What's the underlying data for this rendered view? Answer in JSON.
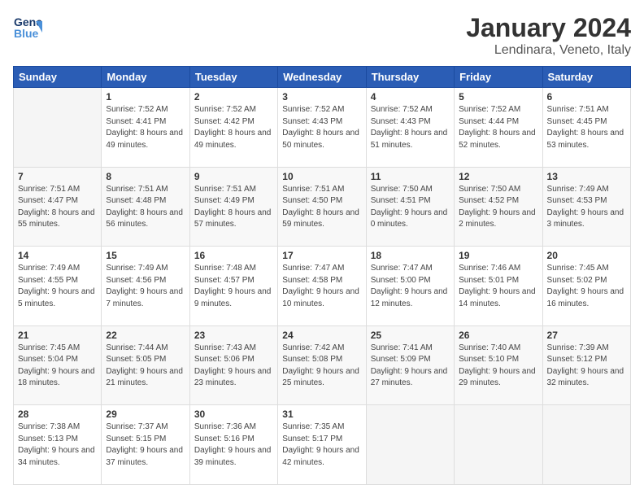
{
  "header": {
    "logo_line1": "General",
    "logo_line2": "Blue",
    "main_title": "January 2024",
    "subtitle": "Lendinara, Veneto, Italy"
  },
  "weekdays": [
    "Sunday",
    "Monday",
    "Tuesday",
    "Wednesday",
    "Thursday",
    "Friday",
    "Saturday"
  ],
  "weeks": [
    [
      {
        "day": "",
        "sunrise": "",
        "sunset": "",
        "daylight": ""
      },
      {
        "day": "1",
        "sunrise": "Sunrise: 7:52 AM",
        "sunset": "Sunset: 4:41 PM",
        "daylight": "Daylight: 8 hours and 49 minutes."
      },
      {
        "day": "2",
        "sunrise": "Sunrise: 7:52 AM",
        "sunset": "Sunset: 4:42 PM",
        "daylight": "Daylight: 8 hours and 49 minutes."
      },
      {
        "day": "3",
        "sunrise": "Sunrise: 7:52 AM",
        "sunset": "Sunset: 4:43 PM",
        "daylight": "Daylight: 8 hours and 50 minutes."
      },
      {
        "day": "4",
        "sunrise": "Sunrise: 7:52 AM",
        "sunset": "Sunset: 4:43 PM",
        "daylight": "Daylight: 8 hours and 51 minutes."
      },
      {
        "day": "5",
        "sunrise": "Sunrise: 7:52 AM",
        "sunset": "Sunset: 4:44 PM",
        "daylight": "Daylight: 8 hours and 52 minutes."
      },
      {
        "day": "6",
        "sunrise": "Sunrise: 7:51 AM",
        "sunset": "Sunset: 4:45 PM",
        "daylight": "Daylight: 8 hours and 53 minutes."
      }
    ],
    [
      {
        "day": "7",
        "sunrise": "Sunrise: 7:51 AM",
        "sunset": "Sunset: 4:47 PM",
        "daylight": "Daylight: 8 hours and 55 minutes."
      },
      {
        "day": "8",
        "sunrise": "Sunrise: 7:51 AM",
        "sunset": "Sunset: 4:48 PM",
        "daylight": "Daylight: 8 hours and 56 minutes."
      },
      {
        "day": "9",
        "sunrise": "Sunrise: 7:51 AM",
        "sunset": "Sunset: 4:49 PM",
        "daylight": "Daylight: 8 hours and 57 minutes."
      },
      {
        "day": "10",
        "sunrise": "Sunrise: 7:51 AM",
        "sunset": "Sunset: 4:50 PM",
        "daylight": "Daylight: 8 hours and 59 minutes."
      },
      {
        "day": "11",
        "sunrise": "Sunrise: 7:50 AM",
        "sunset": "Sunset: 4:51 PM",
        "daylight": "Daylight: 9 hours and 0 minutes."
      },
      {
        "day": "12",
        "sunrise": "Sunrise: 7:50 AM",
        "sunset": "Sunset: 4:52 PM",
        "daylight": "Daylight: 9 hours and 2 minutes."
      },
      {
        "day": "13",
        "sunrise": "Sunrise: 7:49 AM",
        "sunset": "Sunset: 4:53 PM",
        "daylight": "Daylight: 9 hours and 3 minutes."
      }
    ],
    [
      {
        "day": "14",
        "sunrise": "Sunrise: 7:49 AM",
        "sunset": "Sunset: 4:55 PM",
        "daylight": "Daylight: 9 hours and 5 minutes."
      },
      {
        "day": "15",
        "sunrise": "Sunrise: 7:49 AM",
        "sunset": "Sunset: 4:56 PM",
        "daylight": "Daylight: 9 hours and 7 minutes."
      },
      {
        "day": "16",
        "sunrise": "Sunrise: 7:48 AM",
        "sunset": "Sunset: 4:57 PM",
        "daylight": "Daylight: 9 hours and 9 minutes."
      },
      {
        "day": "17",
        "sunrise": "Sunrise: 7:47 AM",
        "sunset": "Sunset: 4:58 PM",
        "daylight": "Daylight: 9 hours and 10 minutes."
      },
      {
        "day": "18",
        "sunrise": "Sunrise: 7:47 AM",
        "sunset": "Sunset: 5:00 PM",
        "daylight": "Daylight: 9 hours and 12 minutes."
      },
      {
        "day": "19",
        "sunrise": "Sunrise: 7:46 AM",
        "sunset": "Sunset: 5:01 PM",
        "daylight": "Daylight: 9 hours and 14 minutes."
      },
      {
        "day": "20",
        "sunrise": "Sunrise: 7:45 AM",
        "sunset": "Sunset: 5:02 PM",
        "daylight": "Daylight: 9 hours and 16 minutes."
      }
    ],
    [
      {
        "day": "21",
        "sunrise": "Sunrise: 7:45 AM",
        "sunset": "Sunset: 5:04 PM",
        "daylight": "Daylight: 9 hours and 18 minutes."
      },
      {
        "day": "22",
        "sunrise": "Sunrise: 7:44 AM",
        "sunset": "Sunset: 5:05 PM",
        "daylight": "Daylight: 9 hours and 21 minutes."
      },
      {
        "day": "23",
        "sunrise": "Sunrise: 7:43 AM",
        "sunset": "Sunset: 5:06 PM",
        "daylight": "Daylight: 9 hours and 23 minutes."
      },
      {
        "day": "24",
        "sunrise": "Sunrise: 7:42 AM",
        "sunset": "Sunset: 5:08 PM",
        "daylight": "Daylight: 9 hours and 25 minutes."
      },
      {
        "day": "25",
        "sunrise": "Sunrise: 7:41 AM",
        "sunset": "Sunset: 5:09 PM",
        "daylight": "Daylight: 9 hours and 27 minutes."
      },
      {
        "day": "26",
        "sunrise": "Sunrise: 7:40 AM",
        "sunset": "Sunset: 5:10 PM",
        "daylight": "Daylight: 9 hours and 29 minutes."
      },
      {
        "day": "27",
        "sunrise": "Sunrise: 7:39 AM",
        "sunset": "Sunset: 5:12 PM",
        "daylight": "Daylight: 9 hours and 32 minutes."
      }
    ],
    [
      {
        "day": "28",
        "sunrise": "Sunrise: 7:38 AM",
        "sunset": "Sunset: 5:13 PM",
        "daylight": "Daylight: 9 hours and 34 minutes."
      },
      {
        "day": "29",
        "sunrise": "Sunrise: 7:37 AM",
        "sunset": "Sunset: 5:15 PM",
        "daylight": "Daylight: 9 hours and 37 minutes."
      },
      {
        "day": "30",
        "sunrise": "Sunrise: 7:36 AM",
        "sunset": "Sunset: 5:16 PM",
        "daylight": "Daylight: 9 hours and 39 minutes."
      },
      {
        "day": "31",
        "sunrise": "Sunrise: 7:35 AM",
        "sunset": "Sunset: 5:17 PM",
        "daylight": "Daylight: 9 hours and 42 minutes."
      },
      {
        "day": "",
        "sunrise": "",
        "sunset": "",
        "daylight": ""
      },
      {
        "day": "",
        "sunrise": "",
        "sunset": "",
        "daylight": ""
      },
      {
        "day": "",
        "sunrise": "",
        "sunset": "",
        "daylight": ""
      }
    ]
  ]
}
